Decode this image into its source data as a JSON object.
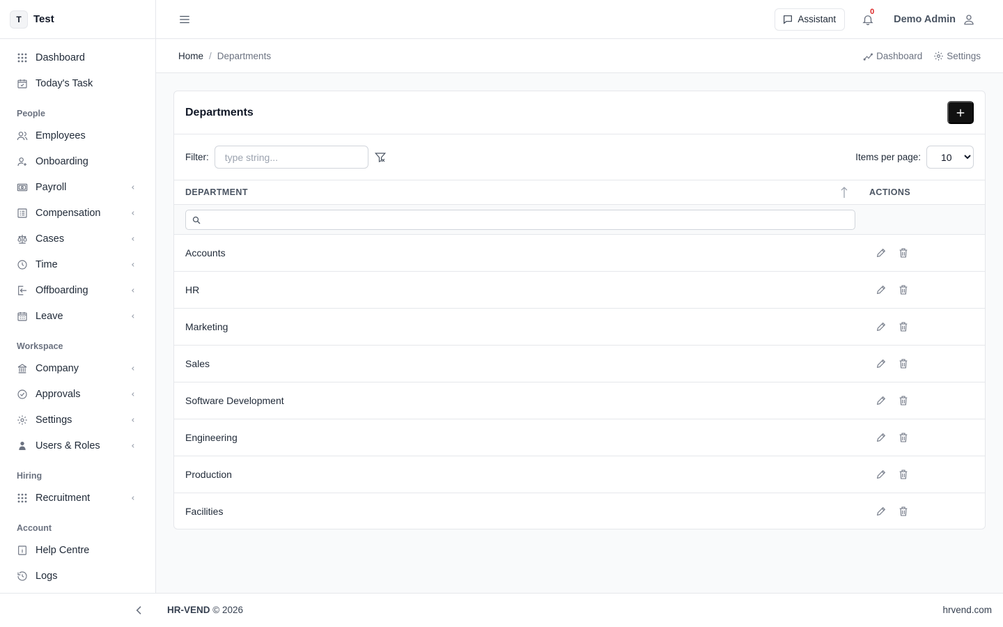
{
  "brand": {
    "badge": "T",
    "name": "Test"
  },
  "sidebar": {
    "top_items": [
      {
        "label": "Dashboard",
        "icon": "grid-icon"
      },
      {
        "label": "Today's Task",
        "icon": "calendar-check-icon"
      }
    ],
    "sections": [
      {
        "title": "People",
        "items": [
          {
            "label": "Employees",
            "icon": "users-icon",
            "chevron": false
          },
          {
            "label": "Onboarding",
            "icon": "user-plus-icon",
            "chevron": false
          },
          {
            "label": "Payroll",
            "icon": "money-icon",
            "chevron": true
          },
          {
            "label": "Compensation",
            "icon": "list-icon",
            "chevron": true
          },
          {
            "label": "Cases",
            "icon": "scale-icon",
            "chevron": true
          },
          {
            "label": "Time",
            "icon": "clock-icon",
            "chevron": true
          },
          {
            "label": "Offboarding",
            "icon": "logout-icon",
            "chevron": true
          },
          {
            "label": "Leave",
            "icon": "calendar-icon",
            "chevron": true
          }
        ]
      },
      {
        "title": "Workspace",
        "items": [
          {
            "label": "Company",
            "icon": "building-icon",
            "chevron": true
          },
          {
            "label": "Approvals",
            "icon": "check-circle-icon",
            "chevron": true
          },
          {
            "label": "Settings",
            "icon": "gear-icon",
            "chevron": true
          },
          {
            "label": "Users & Roles",
            "icon": "user-shield-icon",
            "chevron": true
          }
        ]
      },
      {
        "title": "Hiring",
        "items": [
          {
            "label": "Recruitment",
            "icon": "grid-icon",
            "chevron": true
          }
        ]
      },
      {
        "title": "Account",
        "items": [
          {
            "label": "Help Centre",
            "icon": "info-icon",
            "chevron": false
          },
          {
            "label": "Logs",
            "icon": "history-icon",
            "chevron": false
          }
        ]
      }
    ]
  },
  "topbar": {
    "assistant_label": "Assistant",
    "notification_count": "0",
    "user_name": "Demo Admin"
  },
  "breadcrumb": {
    "home": "Home",
    "separator": "/",
    "current": "Departments"
  },
  "sub_links": {
    "dashboard": "Dashboard",
    "settings": "Settings"
  },
  "card": {
    "title": "Departments",
    "filter_label": "Filter:",
    "filter_placeholder": "type string...",
    "items_per_page_label": "Items per page:",
    "items_per_page_value": "10"
  },
  "table": {
    "columns": {
      "department": "DEPARTMENT",
      "actions": "ACTIONS"
    },
    "rows": [
      "Accounts",
      "HR",
      "Marketing",
      "Sales",
      "Software Development",
      "Engineering",
      "Production",
      "Facilities"
    ]
  },
  "footer": {
    "brand": "HR-VEND",
    "copyright": "© 2026",
    "site": "hrvend.com"
  }
}
